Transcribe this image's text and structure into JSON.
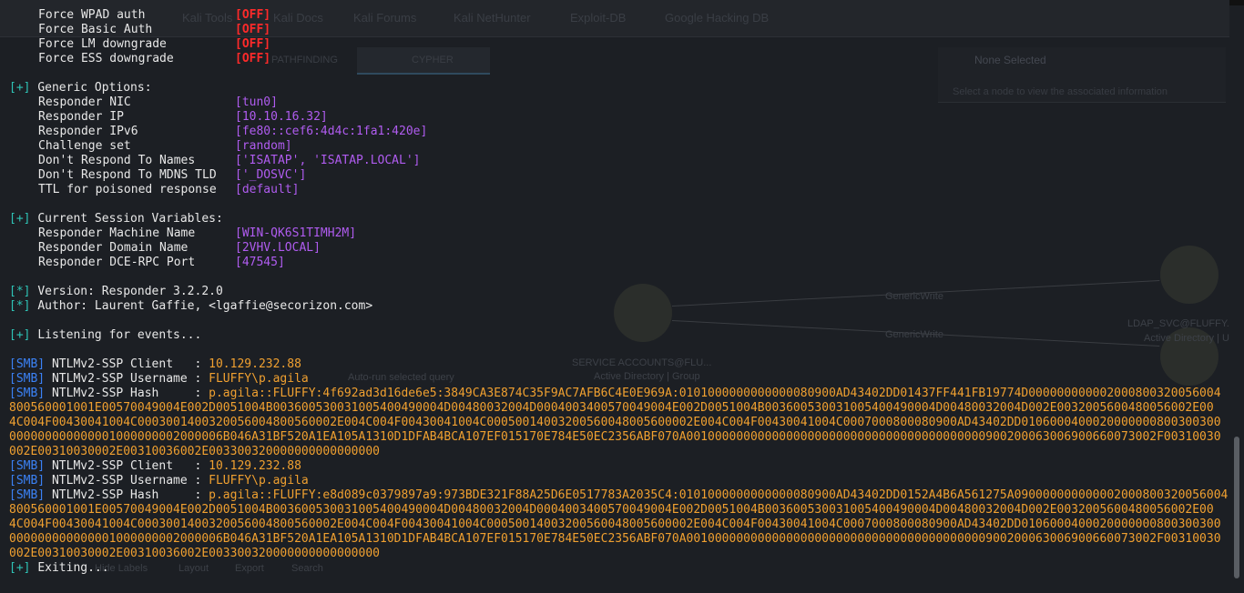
{
  "ghost": {
    "bookmarks": [
      "Kali Tools",
      "Kali Docs",
      "Kali Forums",
      "Kali NetHunter",
      "Exploit-DB",
      "Google Hacking DB"
    ],
    "tabs": [
      "PATHFINDING",
      "CYPHER"
    ],
    "panel_title": "None Selected",
    "panel_sub": "Select a node to view the associated information",
    "node1": "SERVICE ACCOUNTS@FLU...",
    "node1_sub": "Active Directory | Group",
    "node2": "LDAP_SVC@FLUFFY.H",
    "node2_sub": "Active Directory | User",
    "edge1": "GenericWrite",
    "edge2": "GenericWrite",
    "autorun": "Auto-run selected query",
    "bottom": [
      "Hide Labels",
      "Layout",
      "Export",
      "Search"
    ]
  },
  "terminal": {
    "force": [
      {
        "label": "Force WPAD auth",
        "value": "[OFF]"
      },
      {
        "label": "Force Basic Auth",
        "value": "[OFF]"
      },
      {
        "label": "Force LM downgrade",
        "value": "[OFF]"
      },
      {
        "label": "Force ESS downgrade",
        "value": "[OFF]"
      }
    ],
    "generic_header": "Generic Options:",
    "generic": [
      {
        "label": "Responder NIC",
        "value": "[tun0]"
      },
      {
        "label": "Responder IP",
        "value": "[10.10.16.32]"
      },
      {
        "label": "Responder IPv6",
        "value": "[fe80::cef6:4d4c:1fa1:420e]"
      },
      {
        "label": "Challenge set",
        "value": "[random]"
      },
      {
        "label": "Don't Respond To Names",
        "value": "['ISATAP', 'ISATAP.LOCAL']"
      },
      {
        "label": "Don't Respond To MDNS TLD",
        "value": "['_DOSVC']"
      },
      {
        "label": "TTL for poisoned response",
        "value": "[default]"
      }
    ],
    "session_header": "Current Session Variables:",
    "session": [
      {
        "label": "Responder Machine Name",
        "value": "[WIN-QK6S1TIMH2M]"
      },
      {
        "label": "Responder Domain Name",
        "value": "[2VHV.LOCAL]"
      },
      {
        "label": "Responder DCE-RPC Port",
        "value": "[47545]"
      }
    ],
    "version": "Version: Responder 3.2.2.0",
    "author": "Author: Laurent Gaffie, <lgaffie@secorizon.com>",
    "listening": "Listening for events...",
    "plus": "[+]",
    "star": "[*]",
    "smb": "[SMB]",
    "captures": [
      {
        "client_label": "NTLMv2-SSP Client   : ",
        "client": "10.129.232.88",
        "user_label": "NTLMv2-SSP Username : ",
        "user": "FLUFFY\\p.agila",
        "hash_label": "NTLMv2-SSP Hash     : ",
        "hash_lines": [
          "p.agila::FLUFFY:4f692ad3d16de6e5:3849CA3E874C35F9AC7AFB6C4E0E969A:0101000000000000080900AD43402DD01437FF441FB19774D000000000002000800320056004",
          "800560001001E00570049004E002D0051004B003600530031005400490004D00480032004D0004003400570049004E002D0051004B003600530031005400490004D00480032004D002E0032005600480056002E00",
          "4C004F00430041004C0003001400320056004800560002E004C004F00430041004C00050014003200560048005600002E004C004F00430041004C0007000800080900AD43402DD0106000400020000000800300300",
          "000000000000001000000002000006B046A31BF520A1EA105A1310D1DFAB4BCA107EF015170E784E50EC2356ABF070A001000000000000000000000000000000000000000900200063006900660073002F00310030",
          "002E00310030002E00310036002E003300320000000000000000"
        ]
      },
      {
        "client_label": "NTLMv2-SSP Client   : ",
        "client": "10.129.232.88",
        "user_label": "NTLMv2-SSP Username : ",
        "user": "FLUFFY\\p.agila",
        "hash_label": "NTLMv2-SSP Hash     : ",
        "hash_lines": [
          "p.agila::FLUFFY:e8d089c0379897a9:973BDE321F88A25D6E0517783A2035C4:0101000000000000080900AD43402DD0152A4B6A561275A090000000000002000800320056004",
          "800560001001E00570049004E002D0051004B003600530031005400490004D00480032004D0004003400570049004E002D0051004B003600530031005400490004D00480032004D002E0032005600480056002E00",
          "4C004F00430041004C0003001400320056004800560002E004C004F00430041004C00050014003200560048005600002E004C004F00430041004C0007000800080900AD43402DD0106000400020000000800300300",
          "000000000000001000000002000006B046A31BF520A1EA105A1310D1DFAB4BCA107EF015170E784E50EC2356ABF070A001000000000000000000000000000000000000000900200063006900660073002F00310030",
          "002E00310030002E00310036002E003300320000000000000000"
        ]
      }
    ],
    "exiting": "Exiting..."
  }
}
